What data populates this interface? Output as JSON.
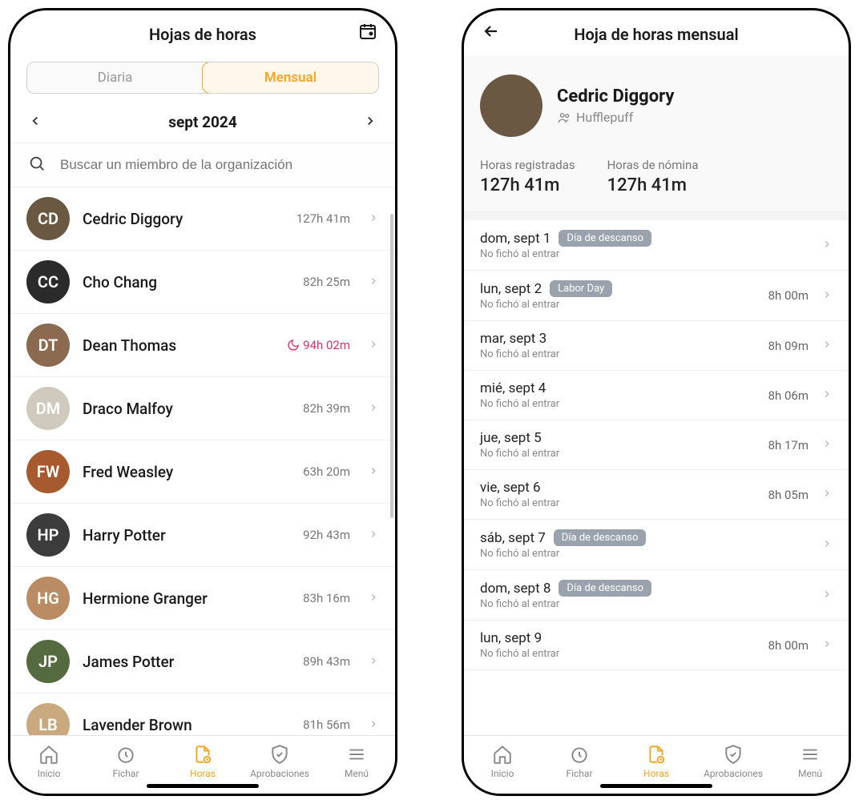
{
  "left": {
    "header_title": "Hojas de horas",
    "seg_daily": "Diaria",
    "seg_monthly": "Mensual",
    "month": "sept 2024",
    "search_placeholder": "Buscar un miembro de la organización",
    "members": [
      {
        "name": "Cedric Diggory",
        "hours": "127h 41m",
        "alert": false,
        "avatar_bg": "#6b5842"
      },
      {
        "name": "Cho Chang",
        "hours": "82h 25m",
        "alert": false,
        "avatar_bg": "#2b2b2b"
      },
      {
        "name": "Dean Thomas",
        "hours": "94h 02m",
        "alert": true,
        "avatar_bg": "#8c6a4f"
      },
      {
        "name": "Draco Malfoy",
        "hours": "82h 39m",
        "alert": false,
        "avatar_bg": "#cfcabd"
      },
      {
        "name": "Fred Weasley",
        "hours": "63h 20m",
        "alert": false,
        "avatar_bg": "#a65a2e"
      },
      {
        "name": "Harry Potter",
        "hours": "92h 43m",
        "alert": false,
        "avatar_bg": "#3c3c3c"
      },
      {
        "name": "Hermione Granger",
        "hours": "83h 16m",
        "alert": false,
        "avatar_bg": "#b98c63"
      },
      {
        "name": "James Potter",
        "hours": "89h 43m",
        "alert": false,
        "avatar_bg": "#556b3f"
      },
      {
        "name": "Lavender Brown",
        "hours": "81h 56m",
        "alert": false,
        "avatar_bg": "#caa97e"
      }
    ]
  },
  "right": {
    "header_title": "Hoja de horas mensual",
    "profile_name": "Cedric Diggory",
    "profile_team": "Hufflepuff",
    "stats": {
      "recorded_label": "Horas registradas",
      "recorded_value": "127h 41m",
      "payroll_label": "Horas de nómina",
      "payroll_value": "127h 41m"
    },
    "no_clock_text": "No fichó al entrar",
    "days": [
      {
        "date": "dom, sept 1",
        "badge": "Día de descanso",
        "hours": ""
      },
      {
        "date": "lun, sept 2",
        "badge": "Labor Day",
        "hours": "8h 00m"
      },
      {
        "date": "mar, sept 3",
        "badge": "",
        "hours": "8h 09m"
      },
      {
        "date": "mié, sept 4",
        "badge": "",
        "hours": "8h 06m"
      },
      {
        "date": "jue, sept 5",
        "badge": "",
        "hours": "8h 17m"
      },
      {
        "date": "vie, sept 6",
        "badge": "",
        "hours": "8h 05m"
      },
      {
        "date": "sáb, sept 7",
        "badge": "Día de descanso",
        "hours": ""
      },
      {
        "date": "dom, sept 8",
        "badge": "Día de descanso",
        "hours": ""
      },
      {
        "date": "lun, sept 9",
        "badge": "",
        "hours": "8h 00m"
      }
    ]
  },
  "tabs": {
    "home": "Inicio",
    "clock": "Fichar",
    "hours": "Horas",
    "approvals": "Aprobaciones",
    "menu": "Menú"
  }
}
